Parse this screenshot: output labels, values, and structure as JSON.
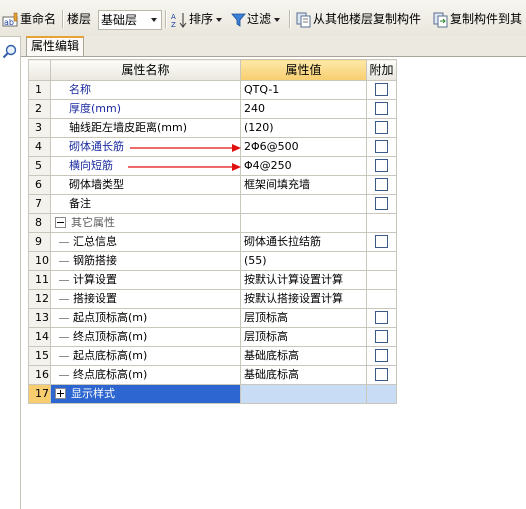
{
  "toolbar": {
    "rename_label": "重命名",
    "floor_label": "楼层",
    "floor_value": "基础层",
    "sort_label": "排序",
    "filter_label": "过滤",
    "copy_from_floor_label": "从其他楼层复制构件",
    "copy_to_label": "复制构件到其"
  },
  "tabs": [
    {
      "label": "属性编辑"
    }
  ],
  "grid": {
    "headers": {
      "name": "属性名称",
      "value": "属性值",
      "extra": "附加"
    },
    "rows": [
      {
        "num": "1",
        "name": "名称",
        "value": "QTQ-1"
      },
      {
        "num": "2",
        "name": "厚度(mm)",
        "value": "240"
      },
      {
        "num": "3",
        "name": "轴线距左墙皮距离(mm)",
        "value": "(120)"
      },
      {
        "num": "4",
        "name": "砌体通长筋",
        "value": "2Φ6@500"
      },
      {
        "num": "5",
        "name": "横向短筋",
        "value": "Φ4@250"
      },
      {
        "num": "6",
        "name": "砌体墙类型",
        "value": "框架间填充墙"
      },
      {
        "num": "7",
        "name": "备注",
        "value": ""
      },
      {
        "num": "8",
        "name": "其它属性",
        "value": ""
      },
      {
        "num": "9",
        "name": "汇总信息",
        "value": "砌体通长拉结筋"
      },
      {
        "num": "10",
        "name": "钢筋搭接",
        "value": "(55)"
      },
      {
        "num": "11",
        "name": "计算设置",
        "value": "按默认计算设置计算"
      },
      {
        "num": "12",
        "name": "搭接设置",
        "value": "按默认搭接设置计算"
      },
      {
        "num": "13",
        "name": "起点顶标高(m)",
        "value": "层顶标高"
      },
      {
        "num": "14",
        "name": "终点顶标高(m)",
        "value": "层顶标高"
      },
      {
        "num": "15",
        "name": "起点底标高(m)",
        "value": "基础底标高"
      },
      {
        "num": "16",
        "name": "终点底标高(m)",
        "value": "基础底标高"
      },
      {
        "num": "17",
        "name": "显示样式",
        "value": ""
      }
    ]
  },
  "colors": {
    "accent_header": "#f7cd6f",
    "blue_label": "#1c2ba0",
    "selection": "#2d66d0",
    "annotation_arrow": "#e01010"
  }
}
